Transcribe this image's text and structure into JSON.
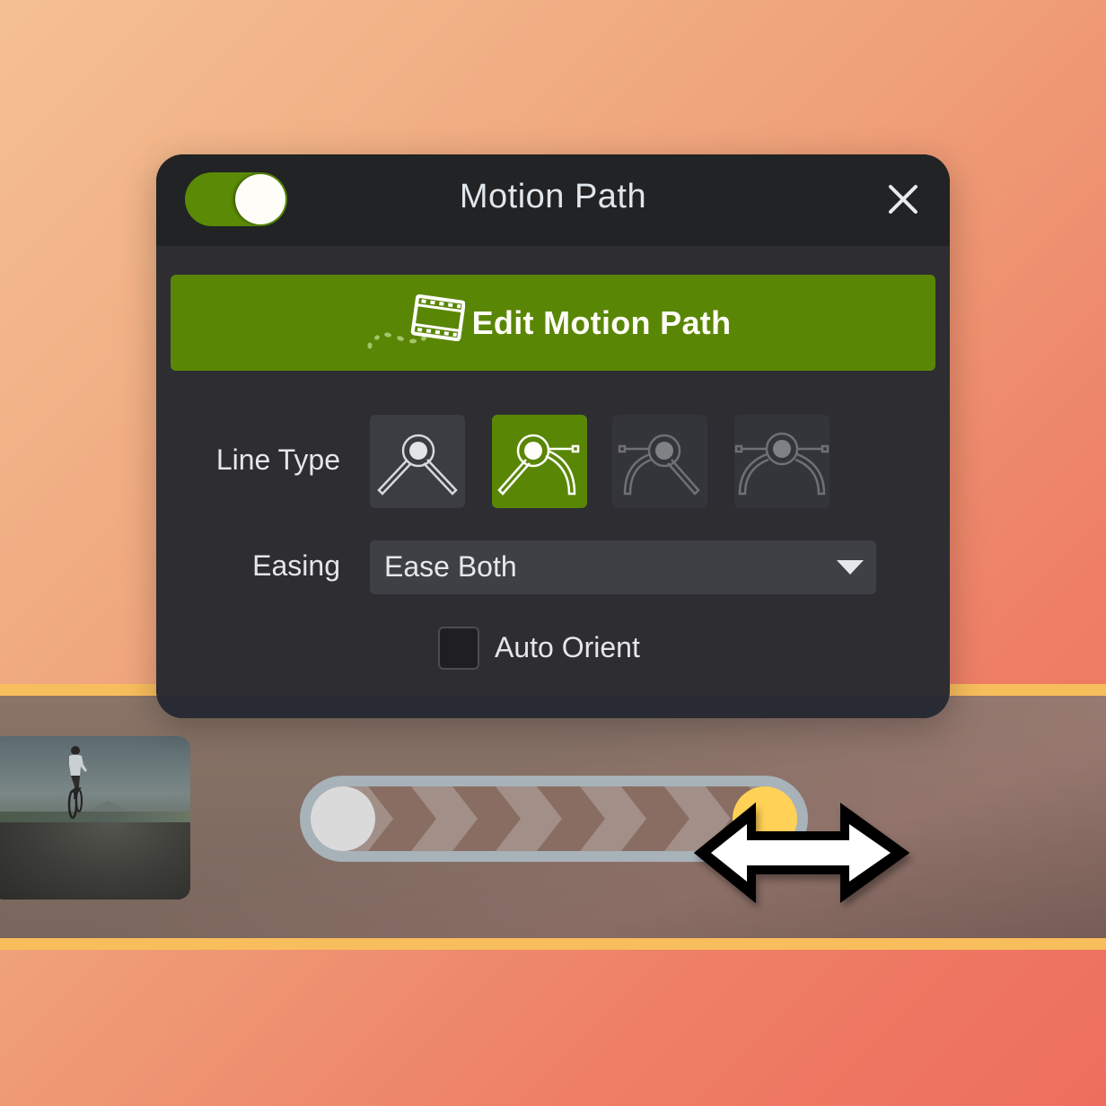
{
  "panel": {
    "title": "Motion Path",
    "enabled": true,
    "close_icon": "close-icon",
    "edit_button": {
      "label": "Edit Motion Path",
      "icon": "film-path-icon"
    },
    "line_type": {
      "label": "Line Type",
      "options": [
        {
          "name": "angle",
          "icon": "line-type-angle-icon",
          "selected": false,
          "enabled": true
        },
        {
          "name": "angle-to-curve",
          "icon": "line-type-angle-curve-icon",
          "selected": true,
          "enabled": true
        },
        {
          "name": "curve-to-angle",
          "icon": "line-type-curve-angle-icon",
          "selected": false,
          "enabled": false
        },
        {
          "name": "curve",
          "icon": "line-type-curve-icon",
          "selected": false,
          "enabled": false
        }
      ]
    },
    "easing": {
      "label": "Easing",
      "value": "Ease Both"
    },
    "auto_orient": {
      "label": "Auto Orient",
      "checked": false
    }
  },
  "timeline": {
    "track_color": "#f9be5c",
    "clip": {
      "thumbnail": "cyclist-on-road-thumbnail"
    },
    "behavior": {
      "start_handle_color": "#dadada",
      "end_handle_color": "#ffd156",
      "cursor": "horizontal-resize-cursor"
    }
  },
  "colors": {
    "accent_green": "#5a8606",
    "panel_bg": "#2d2d32",
    "header_bg": "#222324"
  }
}
